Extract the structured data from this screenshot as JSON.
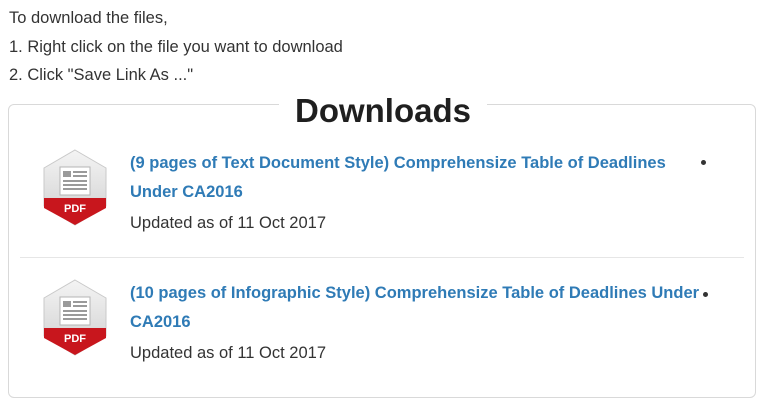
{
  "instructions": {
    "line1": "To download the files,",
    "line2": "1. Right click on the file you want to download",
    "line3": "2. Click \"Save Link As ...\""
  },
  "downloads": {
    "title": "Downloads",
    "items": [
      {
        "icon": "pdf-file-icon",
        "icon_label": "PDF",
        "title": "(9 pages of Text Document Style) Comprehensize Table of Deadlines Under CA2016",
        "updated": "Updated as of 11 Oct 2017"
      },
      {
        "icon": "pdf-file-icon",
        "icon_label": "PDF",
        "title": "(10 pages of Infographic Style) Comprehensize Table of Deadlines Under CA2016",
        "updated": "Updated as of 11 Oct 2017"
      }
    ]
  },
  "colors": {
    "link": "#2f7bb6",
    "text": "#333333",
    "pdf_red": "#c8161d",
    "border": "#d9d9d9"
  }
}
